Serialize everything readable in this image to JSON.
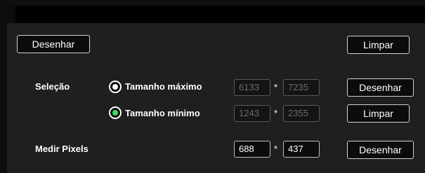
{
  "toolbar": {
    "draw_label": "Desenhar",
    "clear_label": "Limpar"
  },
  "selection": {
    "label": "Seleção",
    "max_size": {
      "label": "Tamanho máximo",
      "width": "6133",
      "height": "7235",
      "draw_label": "Desenhar"
    },
    "min_size": {
      "label": "Tamanho mínimo",
      "width": "1243",
      "height": "2355",
      "clear_label": "Limpar"
    }
  },
  "measure": {
    "label": "Medir Pixels",
    "width": "688",
    "height": "437",
    "draw_label": "Desenhar"
  },
  "separator": "*",
  "colors": {
    "panel": "#1f1f1f",
    "radio_selected_accent": "#3ddc66",
    "disabled_text": "#6b6b6b"
  }
}
